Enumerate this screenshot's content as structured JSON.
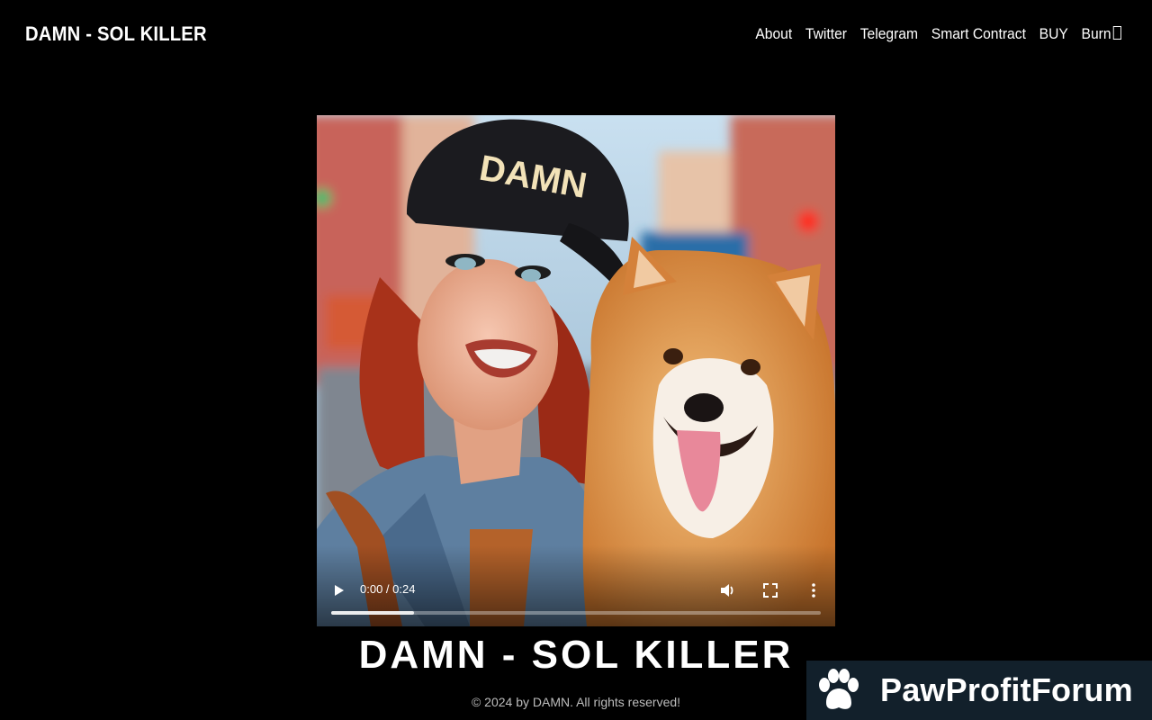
{
  "navbar": {
    "brand": "DAMN - SOL KILLER",
    "links": [
      "About",
      "Twitter",
      "Telegram",
      "Smart Contract",
      "BUY",
      "Burn"
    ]
  },
  "video": {
    "cap_text": "DAMN",
    "time": "0:00 / 0:24",
    "progress": 0.17,
    "icons": {
      "play": "play-icon",
      "volume": "volume-icon",
      "fullscreen": "fullscreen-icon",
      "more": "more-options-icon"
    }
  },
  "hero": {
    "title": "DAMN - SOL KILLER",
    "copyright": "© 2024 by DAMN. All rights reserved!"
  },
  "watermark": {
    "text": "PawProfitForum",
    "icon": "paw-icon"
  },
  "colors": {
    "background": "#000000",
    "text": "#ffffff",
    "watermark_bg": "#12202b"
  }
}
